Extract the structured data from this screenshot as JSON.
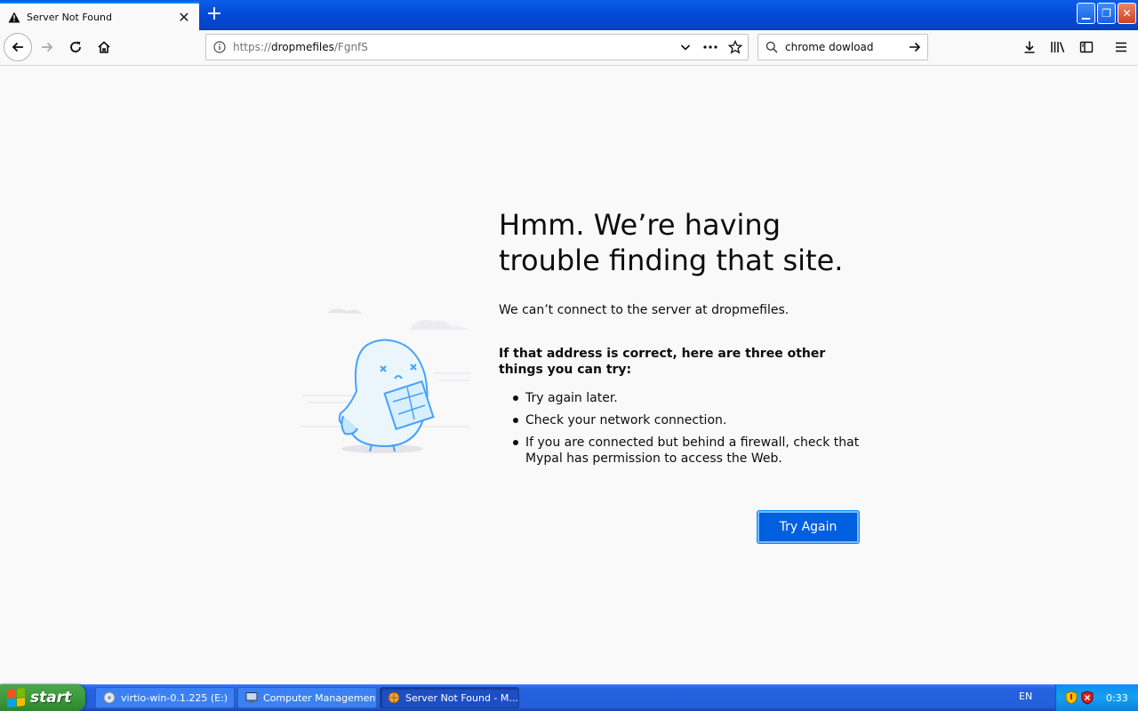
{
  "tab": {
    "title": "Server Not Found",
    "close": "✕"
  },
  "newtab": "+",
  "window": {
    "minimize": "▁",
    "maximize": "❐",
    "close": "✕"
  },
  "urlbar": {
    "url_prefix": "https://",
    "url_host": "dropmefiles",
    "url_path": "/FgnfS"
  },
  "search": {
    "value": "chrome dowload"
  },
  "error": {
    "title": "Hmm. We’re having trouble finding that site.",
    "description": "We can’t connect to the server at dropmefiles.",
    "suggest_heading": "If that address is correct, here are three other things you can try:",
    "suggestions": [
      "Try again later.",
      "Check your network connection.",
      "If you are connected but behind a firewall, check that Mypal has permission to access the Web."
    ],
    "try_again_label": "Try Again"
  },
  "taskbar": {
    "start_label": "start",
    "tasks": [
      "virtio-win-0.1.225 (E:)",
      "Computer Management",
      "Server Not Found - M..."
    ],
    "language": "EN",
    "clock": "0:33"
  },
  "colors": {
    "accent": "#0060df",
    "taskbar": "#245edb",
    "start": "#3c9b3c"
  }
}
